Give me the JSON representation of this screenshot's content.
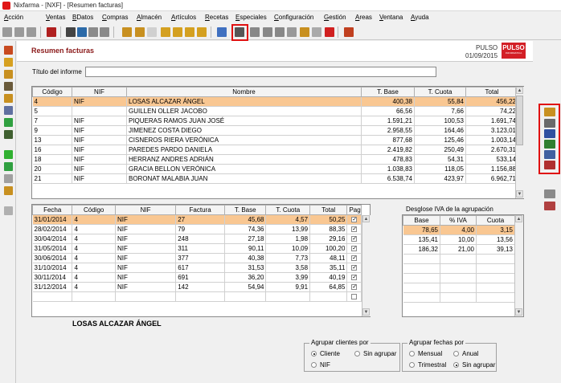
{
  "window": {
    "title": "Nixfarma - [NXF] - [Resumen facturas]"
  },
  "menu": [
    "Acción",
    "Ventas",
    "BDatos",
    "Compras",
    "Almacén",
    "Artículos",
    "Recetas",
    "Especiales",
    "Configuración",
    "Gestión",
    "Areas",
    "Ventana",
    "Ayuda"
  ],
  "header": {
    "title": "Resumen facturas",
    "brand_name": "PULSO",
    "date": "01/09/2015",
    "logo_text": "PULSO",
    "logo_sub": "INFORMATICA"
  },
  "report": {
    "label": "Título del informe",
    "value": ""
  },
  "clients": {
    "columns": [
      "Código",
      "NIF",
      "Nombre",
      "T. Base",
      "T. Cuota",
      "Total"
    ],
    "rows": [
      [
        "4",
        "NIF",
        "LOSAS ALCAZAR ÁNGEL",
        "400,38",
        "55,84",
        "456,22"
      ],
      [
        "5",
        "",
        "GUILLEN OLLER JACOBO",
        "66,56",
        "7,66",
        "74,22"
      ],
      [
        "7",
        "NIF",
        "PIQUERAS RAMOS JUAN JOSÉ",
        "1.591,21",
        "100,53",
        "1.691,74"
      ],
      [
        "9",
        "NIF",
        "JIMENEZ COSTA DIEGO",
        "2.958,55",
        "164,46",
        "3.123,01"
      ],
      [
        "13",
        "NIF",
        "CISNEROS RIERA VERÓNICA",
        "877,68",
        "125,46",
        "1.003,14"
      ],
      [
        "16",
        "NIF",
        "PAREDES PARDO DANIELA",
        "2.419,82",
        "250,49",
        "2.670,31"
      ],
      [
        "18",
        "NIF",
        "HERRANZ ANDRES ADRIÁN",
        "478,83",
        "54,31",
        "533,14"
      ],
      [
        "20",
        "NIF",
        "GRACIA BELLON VERÓNICA",
        "1.038,83",
        "118,05",
        "1.156,88"
      ],
      [
        "21",
        "NIF",
        "BORONAT MALABIA JUAN",
        "6.538,74",
        "423,97",
        "6.962,71"
      ]
    ]
  },
  "invoices": {
    "columns": [
      "Fecha",
      "Código",
      "NIF",
      "Factura",
      "T. Base",
      "T. Cuota",
      "Total",
      "Pag."
    ],
    "rows": [
      [
        "31/01/2014",
        "4",
        "NIF",
        "27",
        "45,68",
        "4,57",
        "50,25",
        "✓"
      ],
      [
        "28/02/2014",
        "4",
        "NIF",
        "79",
        "74,36",
        "13,99",
        "88,35",
        "✓"
      ],
      [
        "30/04/2014",
        "4",
        "NIF",
        "248",
        "27,18",
        "1,98",
        "29,16",
        "✓"
      ],
      [
        "31/05/2014",
        "4",
        "NIF",
        "311",
        "90,11",
        "10,09",
        "100,20",
        "✓"
      ],
      [
        "30/06/2014",
        "4",
        "NIF",
        "377",
        "40,38",
        "7,73",
        "48,11",
        "✓"
      ],
      [
        "31/10/2014",
        "4",
        "NIF",
        "617",
        "31,53",
        "3,58",
        "35,11",
        "✓"
      ],
      [
        "30/11/2014",
        "4",
        "NIF",
        "691",
        "36,20",
        "3,99",
        "40,19",
        "✓"
      ],
      [
        "31/12/2014",
        "4",
        "NIF",
        "142",
        "54,94",
        "9,91",
        "64,85",
        "✓"
      ]
    ]
  },
  "vat": {
    "title": "Desglose IVA de la agrupación",
    "columns": [
      "Base",
      "% IVA",
      "Cuota"
    ],
    "rows": [
      [
        "78,65",
        "4,00",
        "3,15"
      ],
      [
        "135,41",
        "10,00",
        "13,56"
      ],
      [
        "186,32",
        "21,00",
        "39,13"
      ]
    ]
  },
  "selected_client_name": "LOSAS ALCAZAR ÁNGEL",
  "group_clients": {
    "legend": "Agrupar clientes por",
    "options": [
      "Cliente",
      "Sin agrupar",
      "NIF"
    ],
    "selected": "Cliente"
  },
  "group_dates": {
    "legend": "Agrupar fechas por",
    "options": [
      "Mensual",
      "Anual",
      "Trimestral",
      "Sin agrupar"
    ],
    "selected": "Sin agrupar"
  }
}
